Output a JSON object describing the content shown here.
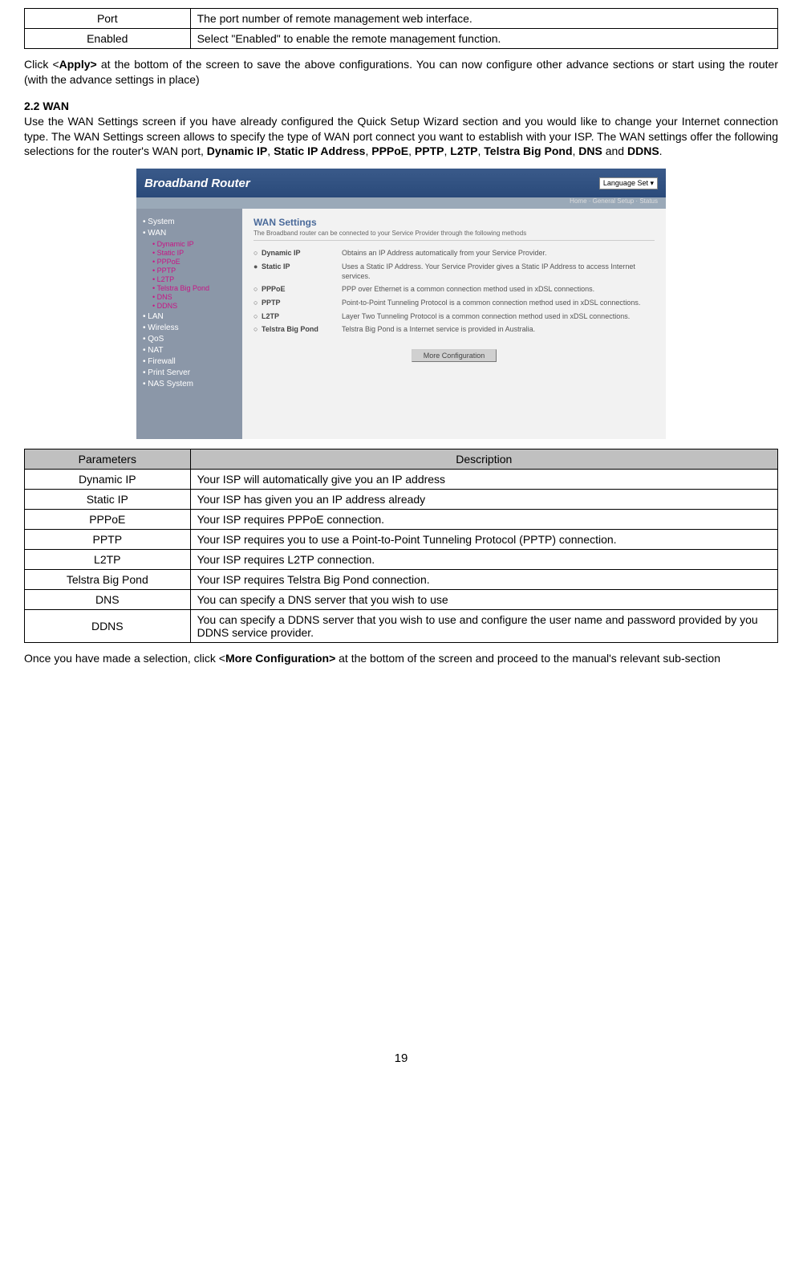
{
  "table1": {
    "rows": [
      {
        "param": "Port",
        "desc": "The port number of remote management web interface."
      },
      {
        "param": "Enabled",
        "desc": "Select \"Enabled\" to enable the remote management function."
      }
    ]
  },
  "para1": {
    "pre": "Click <",
    "bold": "Apply>",
    "post": " at the bottom of the screen to save the above configurations. You can now configure other advance sections or start using the router (with the advance settings in place)"
  },
  "section_heading": "2.2 WAN",
  "para2": {
    "pre": "Use the WAN Settings screen if you have already configured the Quick Setup Wizard section and you would like to change your Internet connection type. The WAN Settings screen allows to specify the type of WAN port connect you want to establish with your ISP. The WAN settings offer the following selections for the router's WAN port, ",
    "b1": "Dynamic IP",
    "c1": ", ",
    "b2": "Static IP Address",
    "c2": ", ",
    "b3": "PPPoE",
    "c3": ", ",
    "b4": "PPTP",
    "c4": ", ",
    "b5": "L2TP",
    "c5": ", ",
    "b6": "Telstra Big Pond",
    "c6": ", ",
    "b7": "DNS",
    "c7": " and ",
    "b8": "DDNS",
    "c8": "."
  },
  "screenshot": {
    "header_title": "Broadband Router",
    "language_label": "Language Set",
    "subheader": "Home · General Setup · Status",
    "sidebar": {
      "top1": "• System",
      "wan": "• WAN",
      "sub_items": [
        "• Dynamic IP",
        "• Static IP",
        "• PPPoE",
        "• PPTP",
        "• L2TP",
        "• Telstra Big Pond",
        "• DNS",
        "• DDNS"
      ],
      "rest": [
        "• LAN",
        "• Wireless",
        "• QoS",
        "• NAT",
        "• Firewall",
        "• Print Server",
        "• NAS System"
      ]
    },
    "main": {
      "title": "WAN Settings",
      "subtitle": "The Broadband router can be connected to your Service Provider through the following methods",
      "rows": [
        {
          "label": "Dynamic IP",
          "desc": "Obtains an IP Address automatically from your Service Provider."
        },
        {
          "label": "Static IP",
          "desc": "Uses a Static IP Address. Your Service Provider gives a Static IP Address to access Internet services."
        },
        {
          "label": "PPPoE",
          "desc": "PPP over Ethernet is a common connection method used in xDSL connections."
        },
        {
          "label": "PPTP",
          "desc": "Point-to-Point Tunneling Protocol is a common connection method used in xDSL connections."
        },
        {
          "label": "L2TP",
          "desc": "Layer Two Tunneling Protocol is a common connection method used in xDSL connections."
        },
        {
          "label": "Telstra Big Pond",
          "desc": "Telstra Big Pond is a Internet service is provided in Australia."
        }
      ],
      "button": "More Configuration"
    }
  },
  "table2": {
    "header_param": "Parameters",
    "header_desc": "Description",
    "rows": [
      {
        "param": "Dynamic IP",
        "desc": "Your ISP will automatically give you an IP address"
      },
      {
        "param": "Static IP",
        "desc": "Your ISP has given you an IP address already"
      },
      {
        "param": "PPPoE",
        "desc": "Your ISP requires PPPoE connection."
      },
      {
        "param": "PPTP",
        "desc": "Your ISP requires you to use a Point-to-Point Tunneling Protocol (PPTP) connection."
      },
      {
        "param": "L2TP",
        "desc": "Your ISP requires L2TP connection."
      },
      {
        "param": "Telstra Big Pond",
        "desc": "Your ISP requires Telstra Big Pond connection."
      },
      {
        "param": "DNS",
        "desc": "You can specify a DNS server that you wish to use"
      },
      {
        "param": "DDNS",
        "desc": "You can specify a DDNS server that you wish to use and configure the user name and password provided by you DDNS service provider."
      }
    ]
  },
  "para3": {
    "pre": "Once you have made a selection, click <",
    "bold": "More Configuration>",
    "post": " at the bottom of the screen and proceed to the manual's relevant sub-section"
  },
  "page_number": "19"
}
